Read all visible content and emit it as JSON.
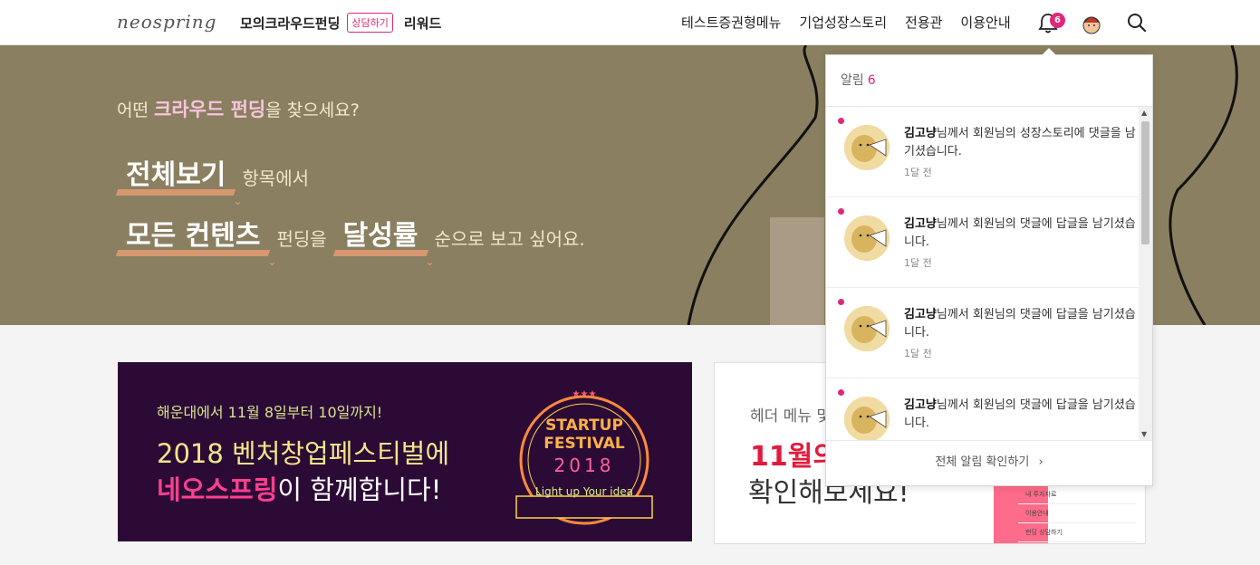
{
  "header": {
    "logo": "neospring",
    "nav_left": {
      "mock_crowdfunding": "모의크라우드펀딩",
      "consult_badge": "상담하기",
      "reward": "리워드"
    },
    "nav_right": [
      "테스트증권형메뉴",
      "기업성장스토리",
      "전용관",
      "이용안내"
    ],
    "notification_count": "6"
  },
  "hero": {
    "question_prefix": "어떤",
    "question_highlight": "크라우드 펀딩",
    "question_suffix": "을 찾으세요?",
    "line1_pick": "전체보기",
    "line1_text": "항목에서",
    "line2_pick1": "모든 컨텐츠",
    "line2_text1": "펀딩을",
    "line2_pick2": "달성률",
    "line2_text2": "순으로 보고 싶어요."
  },
  "banner1": {
    "subtitle": "해운대에서 11월 8일부터 10일까지!",
    "title_line1": "2018 벤처창업페스티벌에",
    "title_highlight": "네오스프링",
    "title_line2_rest": "이 함께합니다!",
    "festival_line1": "STARTUP",
    "festival_line2": "FESTIVAL",
    "festival_year": "2018",
    "festival_ribbon": "Light up Your idea"
  },
  "banner2": {
    "subtitle": "헤더 메뉴 및",
    "title_red": "11월의",
    "title_line2": "확인해보세요!",
    "mini_menu": [
      "내 투자자료",
      "이용안내",
      "펀딩 상담하기"
    ]
  },
  "notifications": {
    "header_label": "알림",
    "header_count": "6",
    "items": [
      {
        "user": "김고냥",
        "message": "님께서 회원님의 성장스토리에 댓글을 남기셨습니다.",
        "time": "1달 전"
      },
      {
        "user": "김고냥",
        "message": "님께서 회원님의 댓글에 답글을 남기셨습니다.",
        "time": "1달 전"
      },
      {
        "user": "김고냥",
        "message": "님께서 회원님의 댓글에 답글을 남기셨습니다.",
        "time": "1달 전"
      },
      {
        "user": "김고냥",
        "message": "님께서 회원님의 댓글에 답글을 남기셨습니다.",
        "time": ""
      }
    ],
    "footer_label": "전체 알림 확인하기"
  },
  "colors": {
    "accent_pink": "#e0287a",
    "hero_bg": "#8a7f60",
    "underline": "#d7976f"
  }
}
